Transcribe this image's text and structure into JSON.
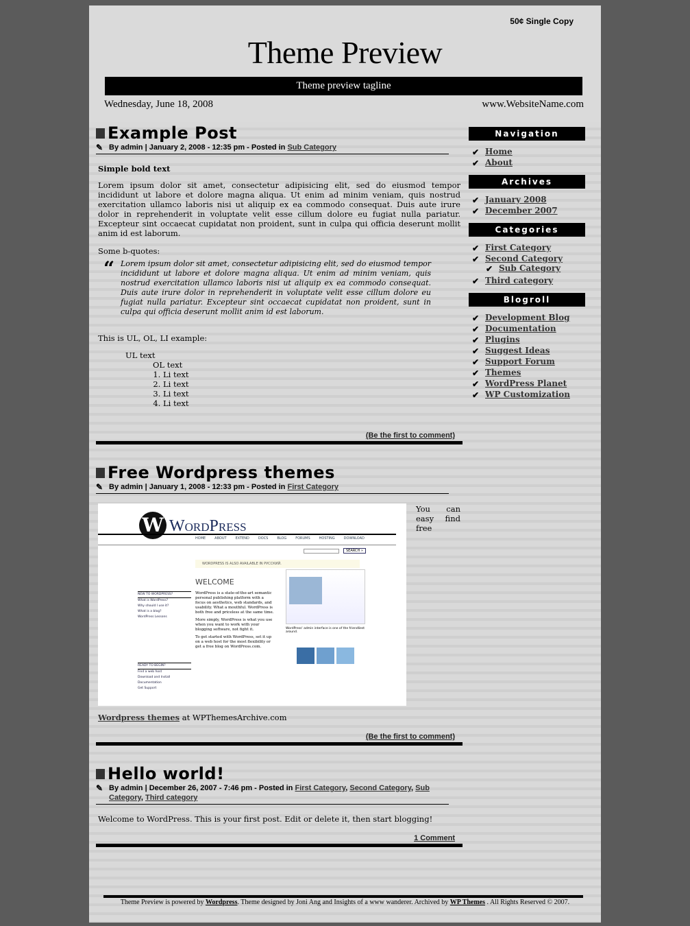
{
  "header": {
    "price": "50¢ Single Copy",
    "title": "Theme Preview",
    "tagline": "Theme preview tagline",
    "date": "Wednesday, June 18, 2008",
    "website": "www.WebsiteName.com"
  },
  "posts": [
    {
      "title": "Example Post",
      "meta_prefix": "By admin | January 2, 2008 - 12:35 pm - Posted in",
      "categories": [
        "Sub Category"
      ],
      "bold": "Simple bold text",
      "para": "Lorem ipsum dolor sit amet, consectetur adipisicing elit, sed do eiusmod tempor incididunt ut labore et dolore magna aliqua. Ut enim ad minim veniam, quis nostrud exercitation ullamco laboris nisi ut aliquip ex ea commodo consequat. Duis aute irure dolor in reprehenderit in voluptate velit esse cillum dolore eu fugiat nulla pariatur. Excepteur sint occaecat cupidatat non proident, sunt in culpa qui officia deserunt mollit anim id est laborum.",
      "bquote_label": "Some b-quotes:",
      "bquote": "Lorem ipsum dolor sit amet, consectetur adipisicing elit, sed do eiusmod tempor incididunt ut labore et dolore magna aliqua. Ut enim ad minim veniam, quis nostrud exercitation ullamco laboris nisi ut aliquip ex ea commodo consequat. Duis aute irure dolor in reprehenderit in voluptate velit esse cillum dolore eu fugiat nulla pariatur. Excepteur sint occaecat cupidatat non proident, sunt in culpa qui officia deserunt mollit anim id est laborum.",
      "list_label": "This is UL, OL, LI example:",
      "ul_text": "UL text",
      "ol_text": "OL text",
      "li": [
        "Li text",
        "Li text",
        "Li text",
        "Li text"
      ],
      "comment": "(Be the first to comment)"
    },
    {
      "title": "Free Wordpress themes",
      "meta_prefix": "By admin | January 1, 2008 - 12:33 pm - Posted in",
      "categories": [
        "First Category"
      ],
      "side_text": "You can easy find free",
      "link": "Wordpress themes",
      "link_suffix": "at WPThemesArchive.com",
      "comment": "(Be the first to comment)"
    },
    {
      "title": "Hello world!",
      "meta_prefix": "By admin | December 26, 2007 - 7:46 pm - Posted in",
      "categories": [
        "First Category",
        "Second Category",
        "Sub Category",
        "Third category"
      ],
      "para": "Welcome to WordPress. This is your first post. Edit or delete it, then start blogging!",
      "comment": "1 Comment"
    }
  ],
  "wp_image": {
    "logo": "WordPress",
    "nav": [
      "HOME",
      "ABOUT",
      "EXTEND",
      "DOCS",
      "BLOG",
      "FORUMS",
      "HOSTING",
      "DOWNLOAD"
    ],
    "search": "SEARCH »",
    "notice": "WORDPRESS IS ALSO AVAILABLE IN РУССКИЙ.",
    "welcome": "WELCOME",
    "new_head": "NEW TO WORDPRESS?",
    "new_items": [
      "What is WordPress?",
      "Why should I use it?",
      "What is a blog?",
      "WordPress Lessons"
    ],
    "ready_head": "READY TO BEGIN?",
    "ready_items": [
      "Find a web host",
      "Download and Install",
      "Documentation",
      "Get Support"
    ],
    "text1": "WordPress is a state-of-the-art semantic personal publishing platform with a focus on aesthetics, web standards, and usability. What a mouthful. WordPress is both free and priceless at the same time.",
    "text2": "More simply, WordPress is what you use when you want to work with your blogging software, not fight it.",
    "text3": "To get started with WordPress, set it up on a web host for the most flexibility or get a free blog on WordPress.com.",
    "caption": "WordPress' admin interface is one of the friendliest around."
  },
  "sidebar": [
    {
      "heading": "Navigation",
      "items": [
        {
          "label": "Home"
        },
        {
          "label": "About"
        }
      ]
    },
    {
      "heading": "Archives",
      "items": [
        {
          "label": "January 2008"
        },
        {
          "label": "December 2007"
        }
      ]
    },
    {
      "heading": "Categories",
      "items": [
        {
          "label": "First Category"
        },
        {
          "label": "Second Category"
        },
        {
          "label": "Sub Category",
          "sub": true
        },
        {
          "label": "Third category"
        }
      ]
    },
    {
      "heading": "Blogroll",
      "items": [
        {
          "label": "Development Blog"
        },
        {
          "label": "Documentation"
        },
        {
          "label": "Plugins"
        },
        {
          "label": "Suggest Ideas"
        },
        {
          "label": "Support Forum"
        },
        {
          "label": "Themes"
        },
        {
          "label": "WordPress Planet"
        },
        {
          "label": "WP Customization"
        }
      ]
    }
  ],
  "footer": {
    "t1": "Theme Preview is powered by",
    "l1": "Wordpress",
    "t2": ". Theme designed by Joni Ang and Insights of a www wanderer. Archived by",
    "l2": "WP Themes",
    "t3": ". All Rights Reserved © 2007."
  }
}
